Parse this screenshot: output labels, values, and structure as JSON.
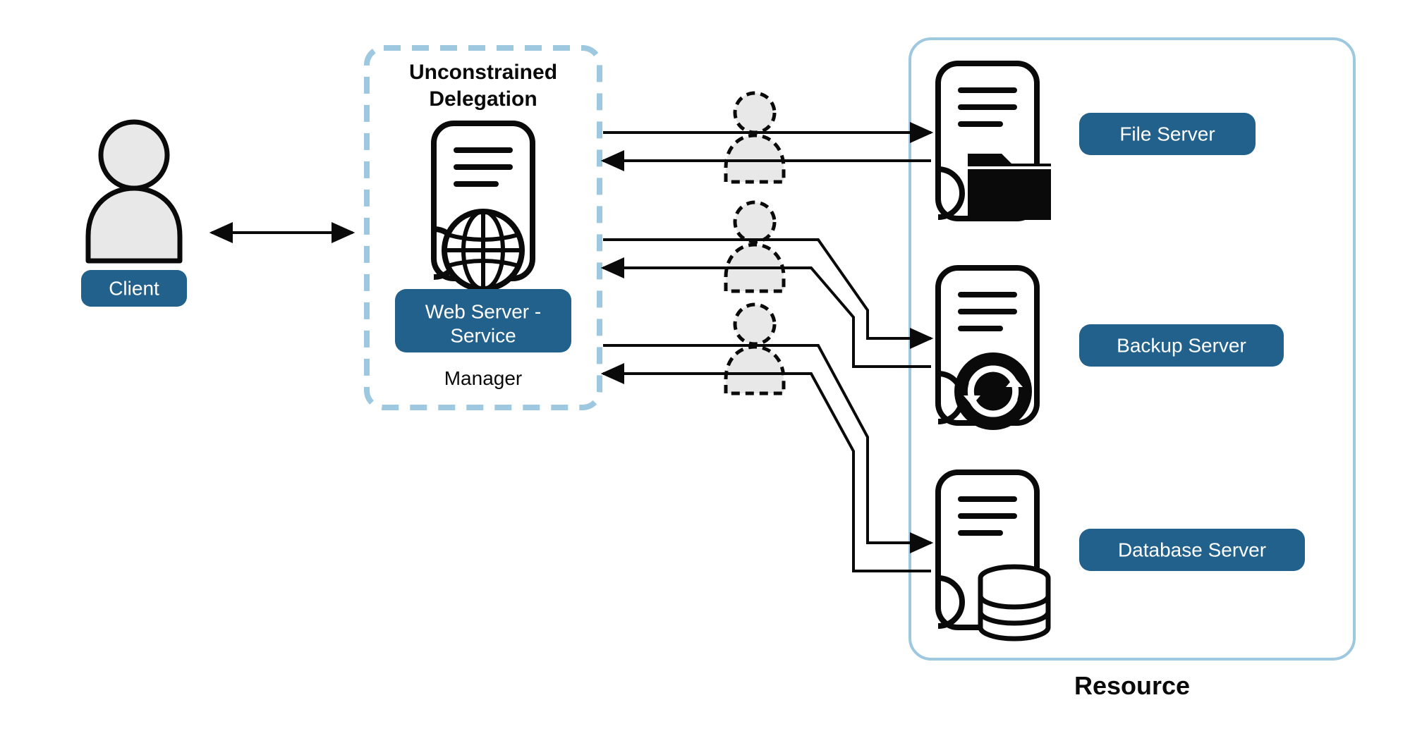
{
  "client": {
    "label": "Client"
  },
  "delegation": {
    "title_line1": "Unconstrained",
    "title_line2": "Delegation",
    "pill_line1": "Web Server -",
    "pill_line2": "Service",
    "subtitle": "Manager"
  },
  "resource": {
    "title": "Resource",
    "servers": [
      {
        "label": "File Server"
      },
      {
        "label": "Backup Server"
      },
      {
        "label": "Database Server"
      }
    ]
  }
}
